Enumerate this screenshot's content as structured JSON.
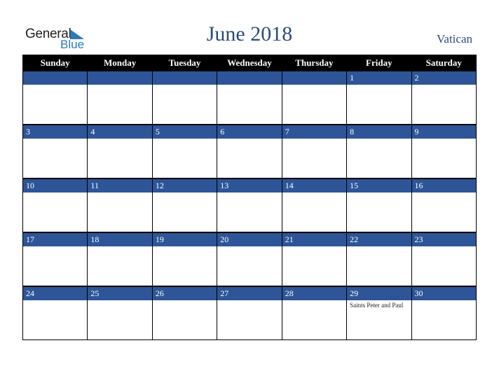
{
  "logo": {
    "general": "General",
    "blue": "Blue"
  },
  "header": {
    "title": "June 2018",
    "country": "Vatican"
  },
  "colors": {
    "header_bg": "#000000",
    "date_bar": "#2e5597",
    "title": "#2b4a7a",
    "logo_blue": "#2a7ab8"
  },
  "days": [
    "Sunday",
    "Monday",
    "Tuesday",
    "Wednesday",
    "Thursday",
    "Friday",
    "Saturday"
  ],
  "weeks": [
    [
      {
        "d": ""
      },
      {
        "d": ""
      },
      {
        "d": ""
      },
      {
        "d": ""
      },
      {
        "d": ""
      },
      {
        "d": "1"
      },
      {
        "d": "2"
      }
    ],
    [
      {
        "d": "3"
      },
      {
        "d": "4"
      },
      {
        "d": "5"
      },
      {
        "d": "6"
      },
      {
        "d": "7"
      },
      {
        "d": "8"
      },
      {
        "d": "9"
      }
    ],
    [
      {
        "d": "10"
      },
      {
        "d": "11"
      },
      {
        "d": "12"
      },
      {
        "d": "13"
      },
      {
        "d": "14"
      },
      {
        "d": "15"
      },
      {
        "d": "16"
      }
    ],
    [
      {
        "d": "17"
      },
      {
        "d": "18"
      },
      {
        "d": "19"
      },
      {
        "d": "20"
      },
      {
        "d": "21"
      },
      {
        "d": "22"
      },
      {
        "d": "23"
      }
    ],
    [
      {
        "d": "24"
      },
      {
        "d": "25"
      },
      {
        "d": "26"
      },
      {
        "d": "27"
      },
      {
        "d": "28"
      },
      {
        "d": "29",
        "note": "Saints Peter and Paul"
      },
      {
        "d": "30"
      }
    ]
  ]
}
